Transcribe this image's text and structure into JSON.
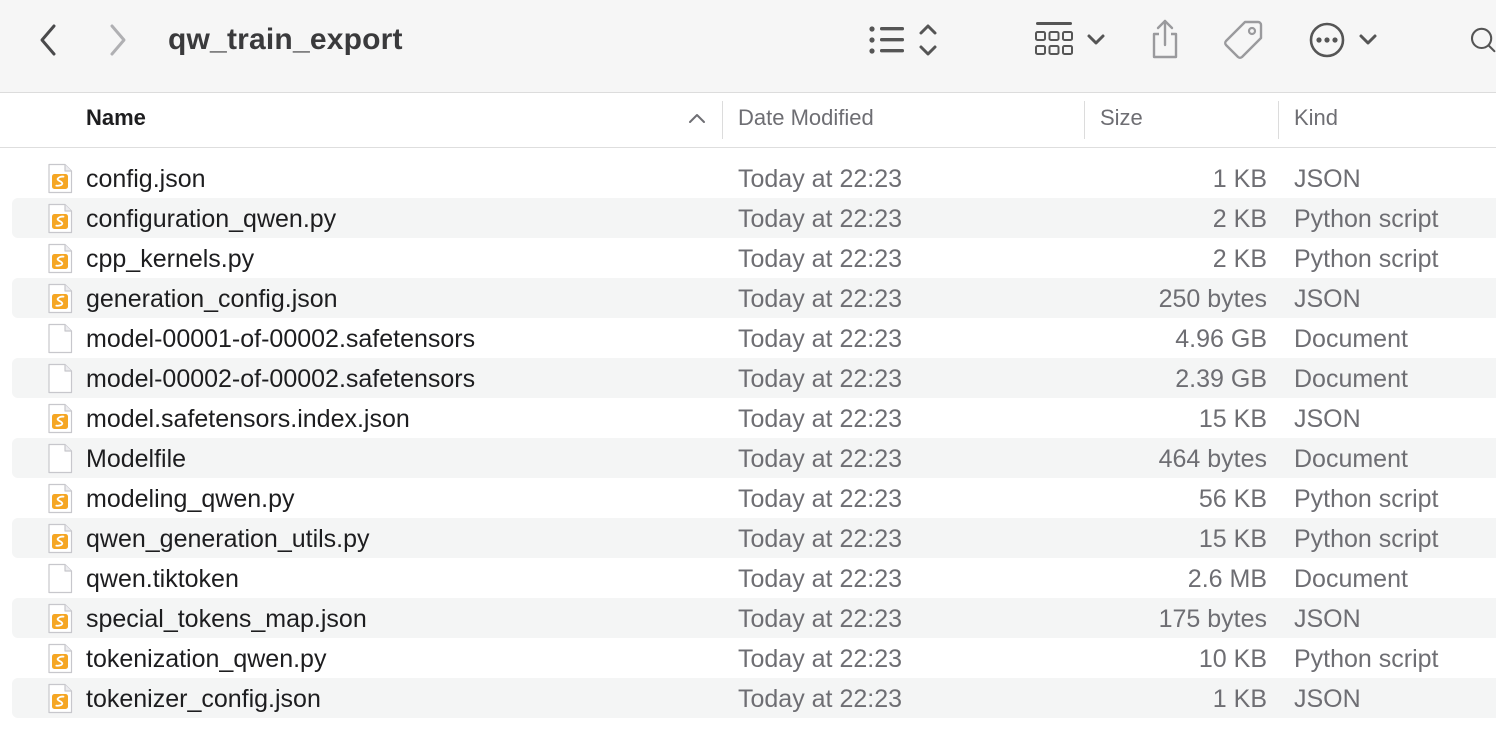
{
  "window": {
    "title": "qw_train_export"
  },
  "toolbar": {
    "back_icon": "chevron-left-icon",
    "forward_icon": "chevron-right-icon",
    "view_list_icon": "list-view-icon",
    "group_icon": "group-grid-icon",
    "share_icon": "share-icon",
    "tag_icon": "tag-icon",
    "more_icon": "ellipsis-circle-icon",
    "search_icon": "search-icon"
  },
  "columns": {
    "name": "Name",
    "date": "Date Modified",
    "size": "Size",
    "kind": "Kind"
  },
  "files": [
    {
      "name": "config.json",
      "date": "Today at 22:23",
      "size": "1 KB",
      "kind": "JSON",
      "icon": "swift-file-icon"
    },
    {
      "name": "configuration_qwen.py",
      "date": "Today at 22:23",
      "size": "2 KB",
      "kind": "Python script",
      "icon": "swift-file-icon"
    },
    {
      "name": "cpp_kernels.py",
      "date": "Today at 22:23",
      "size": "2 KB",
      "kind": "Python script",
      "icon": "swift-file-icon"
    },
    {
      "name": "generation_config.json",
      "date": "Today at 22:23",
      "size": "250 bytes",
      "kind": "JSON",
      "icon": "swift-file-icon"
    },
    {
      "name": "model-00001-of-00002.safetensors",
      "date": "Today at 22:23",
      "size": "4.96 GB",
      "kind": "Document",
      "icon": "blank-document-icon"
    },
    {
      "name": "model-00002-of-00002.safetensors",
      "date": "Today at 22:23",
      "size": "2.39 GB",
      "kind": "Document",
      "icon": "blank-document-icon"
    },
    {
      "name": "model.safetensors.index.json",
      "date": "Today at 22:23",
      "size": "15 KB",
      "kind": "JSON",
      "icon": "swift-file-icon"
    },
    {
      "name": "Modelfile",
      "date": "Today at 22:23",
      "size": "464 bytes",
      "kind": "Document",
      "icon": "blank-document-icon"
    },
    {
      "name": "modeling_qwen.py",
      "date": "Today at 22:23",
      "size": "56 KB",
      "kind": "Python script",
      "icon": "swift-file-icon"
    },
    {
      "name": "qwen_generation_utils.py",
      "date": "Today at 22:23",
      "size": "15 KB",
      "kind": "Python script",
      "icon": "swift-file-icon"
    },
    {
      "name": "qwen.tiktoken",
      "date": "Today at 22:23",
      "size": "2.6 MB",
      "kind": "Document",
      "icon": "blank-document-icon"
    },
    {
      "name": "special_tokens_map.json",
      "date": "Today at 22:23",
      "size": "175 bytes",
      "kind": "JSON",
      "icon": "swift-file-icon"
    },
    {
      "name": "tokenization_qwen.py",
      "date": "Today at 22:23",
      "size": "10 KB",
      "kind": "Python script",
      "icon": "swift-file-icon"
    },
    {
      "name": "tokenizer_config.json",
      "date": "Today at 22:23",
      "size": "1 KB",
      "kind": "JSON",
      "icon": "swift-file-icon"
    }
  ],
  "colors": {
    "accent_icon": "#f5a623",
    "row_alt": "#f4f5f5",
    "toolbar_bg": "#f6f6f6"
  }
}
